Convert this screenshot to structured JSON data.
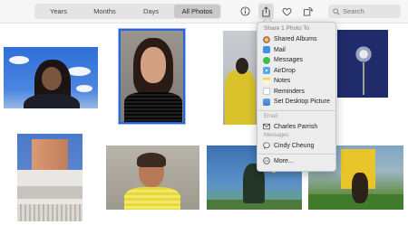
{
  "toolbar": {
    "segments": [
      "Years",
      "Months",
      "Days",
      "All Photos"
    ],
    "active_segment": "All Photos",
    "icons": [
      "info-icon",
      "share-icon",
      "heart-icon",
      "rotate-icon"
    ],
    "search_placeholder": "Search"
  },
  "share_menu": {
    "title": "Share 1 Photo To",
    "services": [
      {
        "label": "Shared Albums",
        "icon": "shared-albums-icon",
        "color": "#f0a32e"
      },
      {
        "label": "Mail",
        "icon": "mail-icon",
        "color": "#3a8ff0"
      },
      {
        "label": "Messages",
        "icon": "messages-icon",
        "color": "#38c24a"
      },
      {
        "label": "AirDrop",
        "icon": "airdrop-icon",
        "color": "#59a8ef"
      },
      {
        "label": "Notes",
        "icon": "notes-icon",
        "color": "#f5d34a"
      },
      {
        "label": "Reminders",
        "icon": "reminders-icon",
        "color": "#ffffff"
      },
      {
        "label": "Set Desktop Picture",
        "icon": "desktop-picture-icon",
        "color": "#5aa9e8"
      }
    ],
    "email_section": "Email",
    "email_contact": "Charles Parrish",
    "messages_section": "Messages",
    "messages_contact": "Cindy Cheung",
    "more_label": "More..."
  },
  "photos": [
    {
      "subject": "portrait-sky"
    },
    {
      "subject": "portrait-selected"
    },
    {
      "subject": "yellow-blanket"
    },
    {
      "subject": "dark-flower"
    },
    {
      "subject": "building"
    },
    {
      "subject": "smiling-man"
    },
    {
      "subject": "dancer"
    },
    {
      "subject": "yellow-sheet-grass"
    }
  ]
}
